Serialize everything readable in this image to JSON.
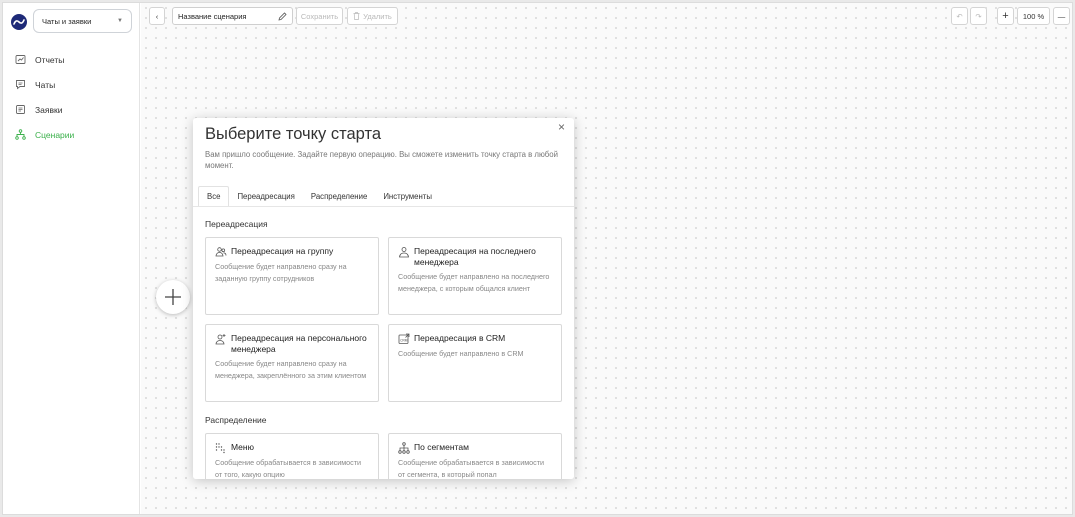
{
  "sidebar": {
    "product_select": "Чаты и заявки",
    "items": [
      {
        "label": "Отчеты",
        "icon": "reports-icon"
      },
      {
        "label": "Чаты",
        "icon": "chat-icon"
      },
      {
        "label": "Заявки",
        "icon": "requests-icon"
      },
      {
        "label": "Сценарии",
        "icon": "scenarios-icon",
        "active": true
      }
    ]
  },
  "toolbar": {
    "back": "‹",
    "scenario_name": "Название сценария",
    "save_label": "Сохранить",
    "delete_label": "Удалить",
    "undo": "↶",
    "redo": "↷",
    "zoom_in": "+",
    "zoom_level": "100 %",
    "zoom_out": "—"
  },
  "modal": {
    "title": "Выберите точку старта",
    "description": "Вам пришло сообщение. Задайте первую операцию. Вы сможете изменить точку старта в любой момент.",
    "close": "×",
    "tabs": [
      "Все",
      "Переадресация",
      "Распределение",
      "Инструменты"
    ],
    "active_tab": "Все",
    "sections": [
      {
        "title": "Переадресация",
        "cards": [
          {
            "title": "Переадресация на группу",
            "desc": "Сообщение будет направлено сразу на заданную группу сотрудников",
            "icon": "group-icon"
          },
          {
            "title": "Переадресация на последнего менеджера",
            "desc": "Сообщение будет направлено на последнего менеджера, с которым общался клиент",
            "icon": "user-icon"
          },
          {
            "title": "Переадресация на персонального менеджера",
            "desc": "Сообщение будет направлено сразу на менеджера, закреплённого за этим клиентом",
            "icon": "personal-manager-icon"
          },
          {
            "title": "Переадресация в CRM",
            "desc": "Сообщение будет направлено в CRM",
            "icon": "crm-icon"
          }
        ]
      },
      {
        "title": "Распределение",
        "cards": [
          {
            "title": "Меню",
            "desc": "Сообщение обрабатывается в зависимости от того, какую опцию",
            "icon": "menu-icon"
          },
          {
            "title": "По сегментам",
            "desc": "Сообщение обрабатывается в зависимости от сегмента, в который попал",
            "icon": "segments-icon"
          }
        ]
      }
    ]
  },
  "canvas": {
    "add_label": "+"
  },
  "colors": {
    "accent_green": "#3ab04a",
    "logo_blue": "#1e2a78"
  }
}
